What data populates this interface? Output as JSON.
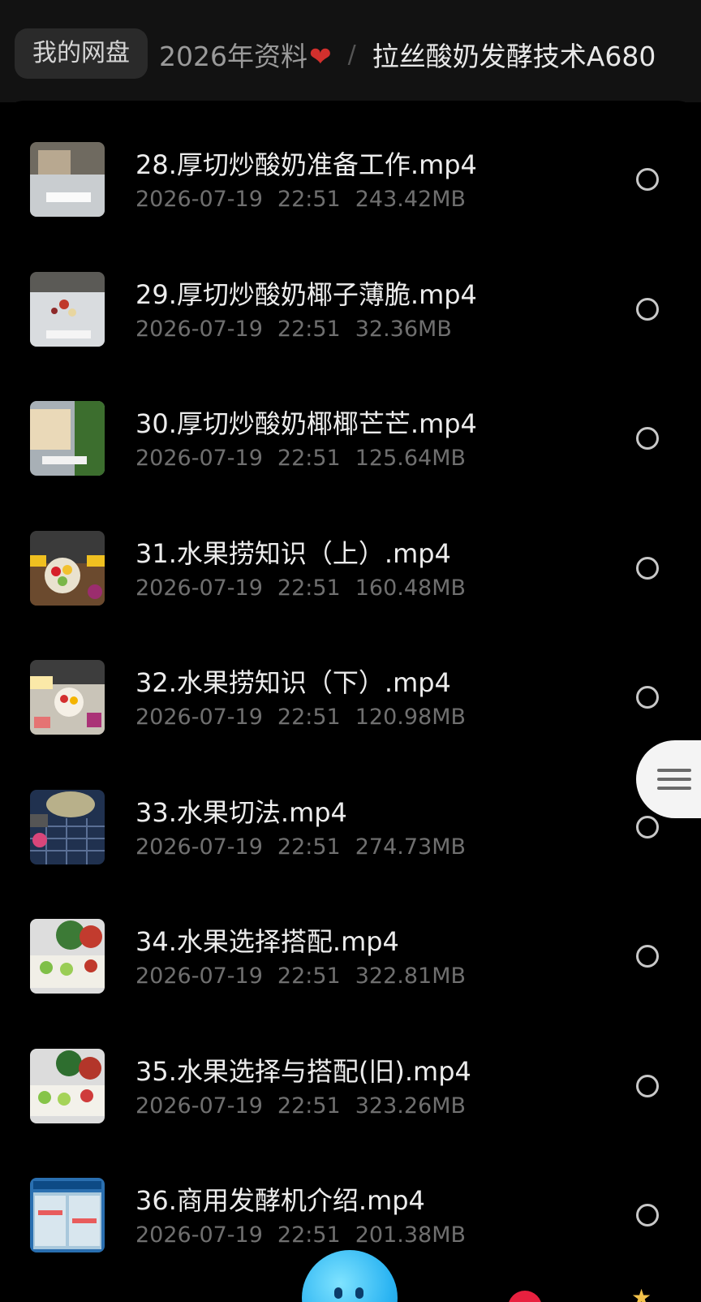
{
  "breadcrumb": {
    "home": "我的网盘",
    "folder": "2026年资料",
    "current": "拉丝酸奶发酵技术A680",
    "separator": "/"
  },
  "files": [
    {
      "name": "28.厚切炒酸奶准备工作.mp4",
      "date": "2026-07-19",
      "time": "22:51",
      "size": "243.42MB",
      "thumb": "prep"
    },
    {
      "name": "29.厚切炒酸奶椰子薄脆.mp4",
      "date": "2026-07-19",
      "time": "22:51",
      "size": "32.36MB",
      "thumb": "coconut"
    },
    {
      "name": "30.厚切炒酸奶椰椰芒芒.mp4",
      "date": "2026-07-19",
      "time": "22:51",
      "size": "125.64MB",
      "thumb": "mango"
    },
    {
      "name": "31.水果捞知识（上）.mp4",
      "date": "2026-07-19",
      "time": "22:51",
      "size": "160.48MB",
      "thumb": "fruitbowl"
    },
    {
      "name": "32.水果捞知识（下）.mp4",
      "date": "2026-07-19",
      "time": "22:51",
      "size": "120.98MB",
      "thumb": "fruitbowl2"
    },
    {
      "name": "33.水果切法.mp4",
      "date": "2026-07-19",
      "time": "22:51",
      "size": "274.73MB",
      "thumb": "cutting"
    },
    {
      "name": "34.水果选择搭配.mp4",
      "date": "2026-07-19",
      "time": "22:51",
      "size": "322.81MB",
      "thumb": "melon"
    },
    {
      "name": "35.水果选择与搭配(旧).mp4",
      "date": "2026-07-19",
      "time": "22:51",
      "size": "323.26MB",
      "thumb": "melon2"
    },
    {
      "name": "36.商用发酵机介绍.mp4",
      "date": "2026-07-19",
      "time": "22:51",
      "size": "201.38MB",
      "thumb": "machine"
    }
  ],
  "colors": {
    "accent_heart": "#d2302d",
    "background": "#000000",
    "header": "#121212"
  },
  "icons": {
    "menu": "hamburger-menu-icon",
    "select": "radio-circle-icon",
    "mascot": "blue-mascot-icon"
  }
}
